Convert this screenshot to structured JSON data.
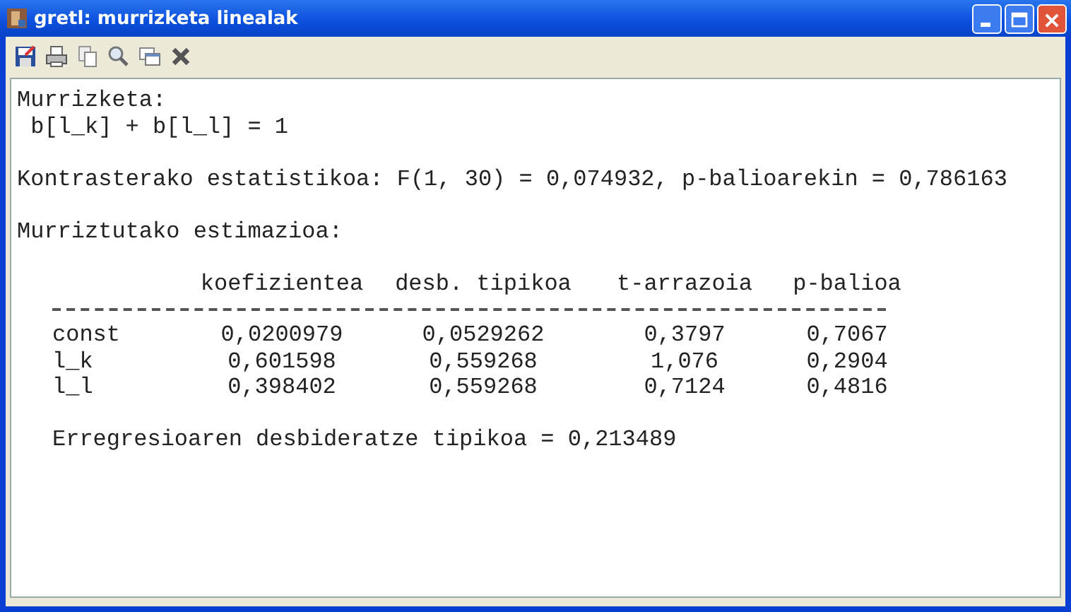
{
  "window": {
    "title": "gretl: murrizketa linealak"
  },
  "output": {
    "restriction_heading": "Murrizketa:",
    "restriction": "b[l_k] + b[l_l] = 1",
    "test_statistic": "Kontrasterako estatistikoa: F(1, 30) = 0,074932, p-balioarekin = 0,786163",
    "estimates_heading": "Murriztutako estimazioa:",
    "table": {
      "columns": [
        "koefizientea",
        "desb. tipikoa",
        "t-arrazoia",
        "p-balioa"
      ],
      "rows": [
        {
          "label": "const",
          "cells": [
            "0,0200979",
            "0,0529262",
            "0,3797",
            "0,7067"
          ]
        },
        {
          "label": "l_k",
          "cells": [
            "0,601598",
            "0,559268",
            "1,076",
            "0,2904"
          ]
        },
        {
          "label": "l_l",
          "cells": [
            "0,398402",
            "0,559268",
            "0,7124",
            "0,4816"
          ]
        }
      ]
    },
    "standard_error": "Erregresioaren desbideratze tipikoa = 0,213489"
  }
}
